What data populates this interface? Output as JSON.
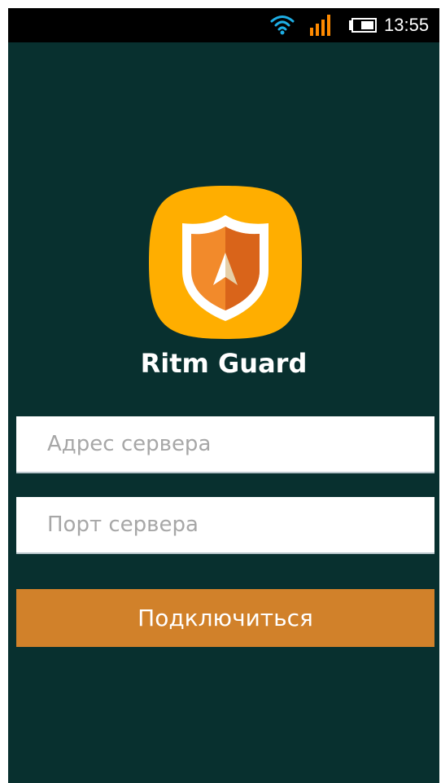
{
  "status_bar": {
    "time": "13:55",
    "icons": [
      "wifi-icon",
      "signal-icon",
      "battery-icon"
    ],
    "colors": {
      "wifi": "#1eaee5",
      "signal": "#ff8a00",
      "battery": "#ffffff"
    }
  },
  "app": {
    "name": "Ritm Guard",
    "logo_icon": "shield-icon",
    "colors": {
      "background": "#08302f",
      "logo": "#ffae00",
      "shield_dark": "#d9641a",
      "shield_light": "#f28a2b"
    }
  },
  "form": {
    "server_address": {
      "placeholder": "Адрес сервера",
      "value": ""
    },
    "server_port": {
      "placeholder": "Порт сервера",
      "value": ""
    },
    "connect_label": "Подключиться",
    "connect_color": "#d1812a"
  }
}
